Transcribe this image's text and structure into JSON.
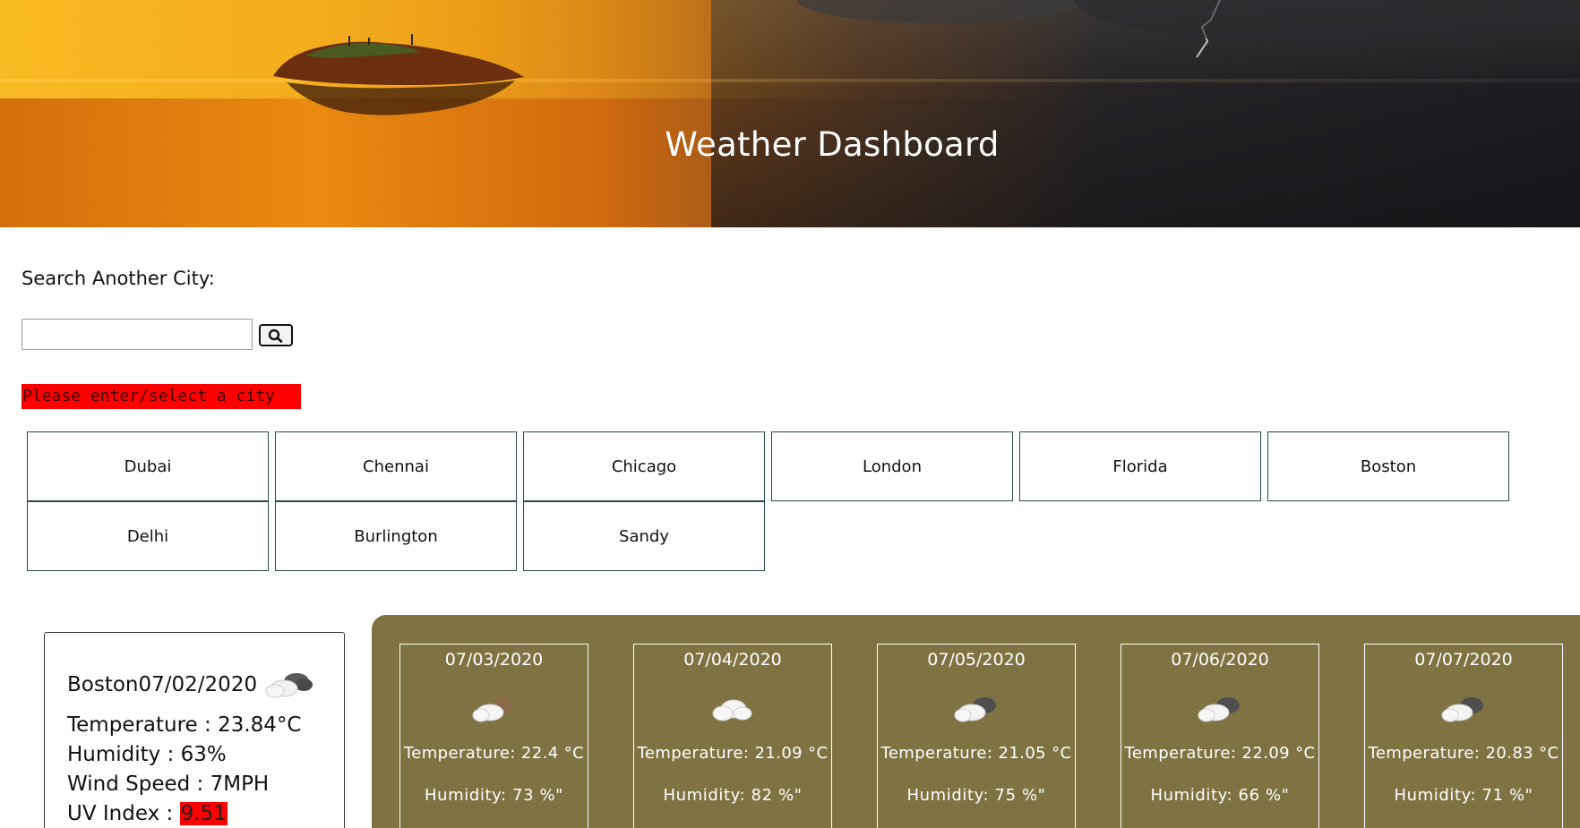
{
  "header": {
    "title": "Weather Dashboard"
  },
  "search": {
    "label": "Search Another City:",
    "value": "",
    "placeholder": "",
    "button_icon": "search-icon",
    "error_message": "Please enter/select a city"
  },
  "cities": [
    "Dubai",
    "Chennai",
    "Chicago",
    "London",
    "Florida",
    "Boston",
    "Delhi",
    "Burlington",
    "Sandy"
  ],
  "current": {
    "city": "Boston",
    "date": "07/02/2020",
    "icon": "partly-cloudy-night-icon",
    "temperature": "Temperature : 23.84°C",
    "humidity": "Humidity : 63%",
    "wind": "Wind Speed : 7MPH",
    "uv_label": "UV Index : ",
    "uv_value": "9.51"
  },
  "forecast": [
    {
      "date": "07/03/2020",
      "icon": "cloud-moon-icon",
      "temp": "Temperature: 22.4 °C",
      "humidity": "Humidity: 73 %\""
    },
    {
      "date": "07/04/2020",
      "icon": "cloud-icon",
      "temp": "Temperature: 21.09 °C",
      "humidity": "Humidity: 82 %\""
    },
    {
      "date": "07/05/2020",
      "icon": "broken-clouds-icon",
      "temp": "Temperature: 21.05 °C",
      "humidity": "Humidity: 75 %\""
    },
    {
      "date": "07/06/2020",
      "icon": "broken-clouds-icon",
      "temp": "Temperature: 22.09 °C",
      "humidity": "Humidity: 66 %\""
    },
    {
      "date": "07/07/2020",
      "icon": "broken-clouds-icon",
      "temp": "Temperature: 20.83 °C",
      "humidity": "Humidity: 71 %\""
    }
  ],
  "colors": {
    "forecast_panel": "#7f7343",
    "error_bg": "#ff0000",
    "uv_bg": "#ff0000",
    "city_button_border": "#2a4a4a"
  }
}
